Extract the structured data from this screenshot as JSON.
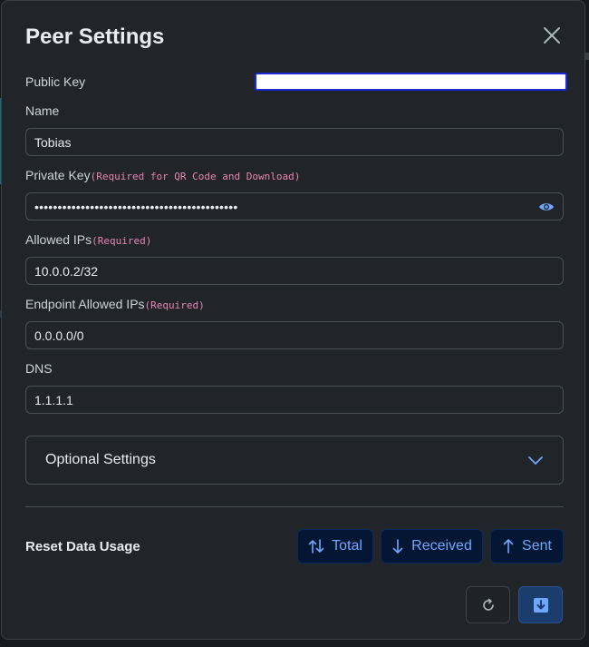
{
  "modal": {
    "title": "Peer Settings",
    "close_icon": "close-icon"
  },
  "fields": {
    "public_key": {
      "label": "Public Key",
      "value": ""
    },
    "name": {
      "label": "Name",
      "value": "Tobias"
    },
    "private_key": {
      "label": "Private Key",
      "note": "(Required for QR Code and Download)",
      "masked_value": "••••••••••••••••••••••••••••••••••••••••••••",
      "toggle_icon": "eye-icon"
    },
    "allowed_ips": {
      "label": "Allowed IPs",
      "note": "(Required)",
      "value": "10.0.0.2/32"
    },
    "endpoint_allowed_ips": {
      "label": "Endpoint Allowed IPs",
      "note": "(Required)",
      "value": "0.0.0.0/0"
    },
    "dns": {
      "label": "DNS",
      "value": "1.1.1.1"
    }
  },
  "optional_settings": {
    "label": "Optional Settings",
    "icon": "chevron-down-icon"
  },
  "reset_data_usage": {
    "label": "Reset Data Usage",
    "buttons": [
      {
        "label": "Total",
        "icon": "arrow-up-down-icon"
      },
      {
        "label": "Received",
        "icon": "arrow-down-icon"
      },
      {
        "label": "Sent",
        "icon": "arrow-up-icon"
      }
    ]
  },
  "footer": {
    "reset_icon": "refresh-icon",
    "save_icon": "download-icon"
  },
  "colors": {
    "modal_bg": "#212529",
    "accent_blue": "#6ea8fe",
    "required_pink": "#e685b5",
    "button_blue_bg": "#031633",
    "save_button_bg": "#1b3d6d"
  }
}
